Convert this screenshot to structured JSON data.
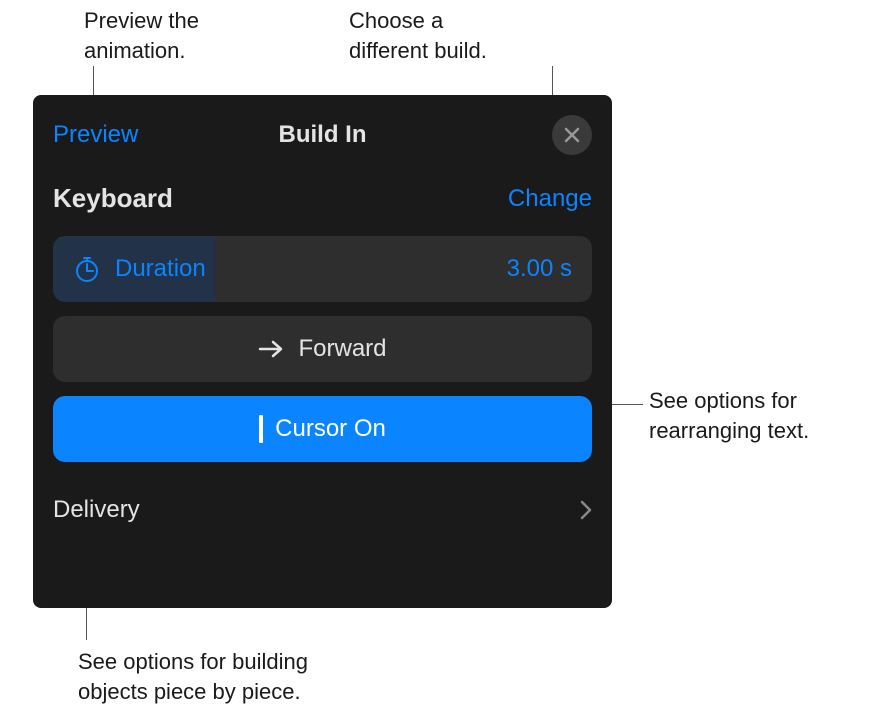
{
  "callouts": {
    "preview": "Preview the\nanimation.",
    "change": "Choose a\ndifferent build.",
    "forward": "See options for\nrearranging text.",
    "delivery": "See options for building\nobjects piece by piece."
  },
  "panel": {
    "preview_link": "Preview",
    "title": "Build In",
    "section_label": "Keyboard",
    "change_link": "Change",
    "duration": {
      "label": "Duration",
      "value": "3.00 s"
    },
    "direction_label": "Forward",
    "cursor_label": "Cursor On",
    "delivery_label": "Delivery"
  }
}
